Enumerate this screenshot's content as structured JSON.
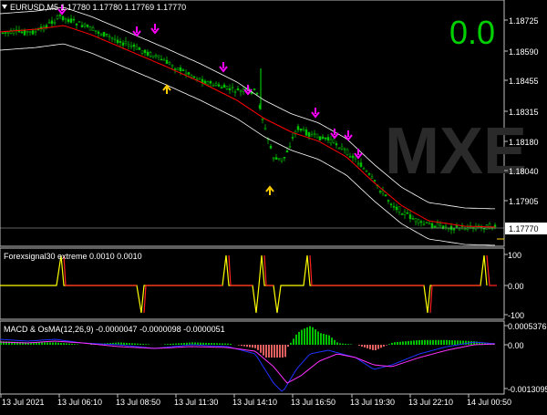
{
  "main": {
    "title": "EURUSD,M5  1.17780 1.17780 1.17769 1.17770",
    "signal_value": "0.0",
    "watermark": "MXE",
    "price_labels": [
      "1.18725",
      "1.18590",
      "1.18455",
      "1.18315",
      "1.18180",
      "1.18040",
      "1.17905"
    ],
    "current_price": "1.17770",
    "colors": {
      "bull": "#00c000",
      "bear": "#00c000",
      "band": "#ffffff",
      "midline": "#ff0000",
      "sell_arrow": "#ff00ff",
      "buy_arrow": "#ffcc00",
      "signal": "#00e000"
    }
  },
  "forexsignal": {
    "title": "Forexsignal30 extreme 0.0010 0.0010",
    "labels": [
      "100",
      "0.00",
      "-100"
    ]
  },
  "macd": {
    "title": "MACD & OsMA(12,26,9) -0.0000047 -0.0000098 -0.0000051",
    "labels": [
      "0.0005376",
      "0.00",
      "-0.0013095"
    ]
  },
  "time_axis": [
    "13 Jul 2021",
    "13 Jul 06:10",
    "13 Jul 08:50",
    "13 Jul 11:30",
    "13 Jul 14:10",
    "13 Jul 16:50",
    "13 Jul 19:30",
    "13 Jul 22:10",
    "14 Jul 00:50"
  ]
}
